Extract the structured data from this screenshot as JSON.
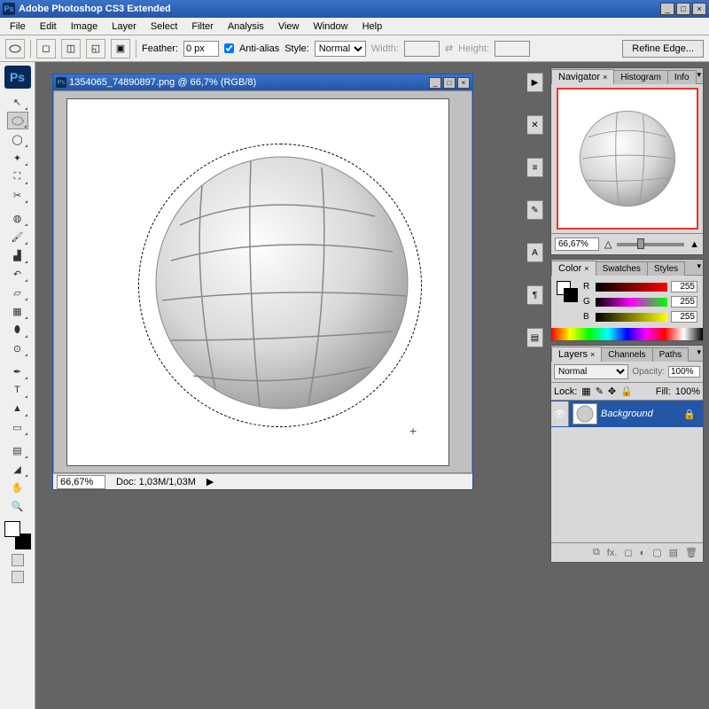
{
  "app": {
    "title": "Adobe Photoshop CS3 Extended",
    "icon_text": "Ps"
  },
  "menu": [
    "File",
    "Edit",
    "Image",
    "Layer",
    "Select",
    "Filter",
    "Analysis",
    "View",
    "Window",
    "Help"
  ],
  "options": {
    "feather_label": "Feather:",
    "feather_value": "0 px",
    "antialias_label": "Anti-alias",
    "antialias_checked": true,
    "style_label": "Style:",
    "style_value": "Normal",
    "width_label": "Width:",
    "width_value": "",
    "height_label": "Height:",
    "height_value": "",
    "refine_label": "Refine Edge..."
  },
  "document": {
    "title": "1354065_74890897.png @ 66,7% (RGB/8)",
    "zoom": "66,67%",
    "doc_size": "Doc: 1,03M/1,03M"
  },
  "navigator": {
    "tabs": [
      "Navigator",
      "Histogram",
      "Info"
    ],
    "zoom": "66,67%"
  },
  "color": {
    "tabs": [
      "Color",
      "Swatches",
      "Styles"
    ],
    "r": "255",
    "g": "255",
    "b": "255",
    "r_label": "R",
    "g_label": "G",
    "b_label": "B"
  },
  "layers": {
    "tabs": [
      "Layers",
      "Channels",
      "Paths"
    ],
    "blend_mode": "Normal",
    "opacity_label": "Opacity:",
    "opacity_value": "100%",
    "lock_label": "Lock:",
    "fill_label": "Fill:",
    "fill_value": "100%",
    "background_name": "Background"
  }
}
